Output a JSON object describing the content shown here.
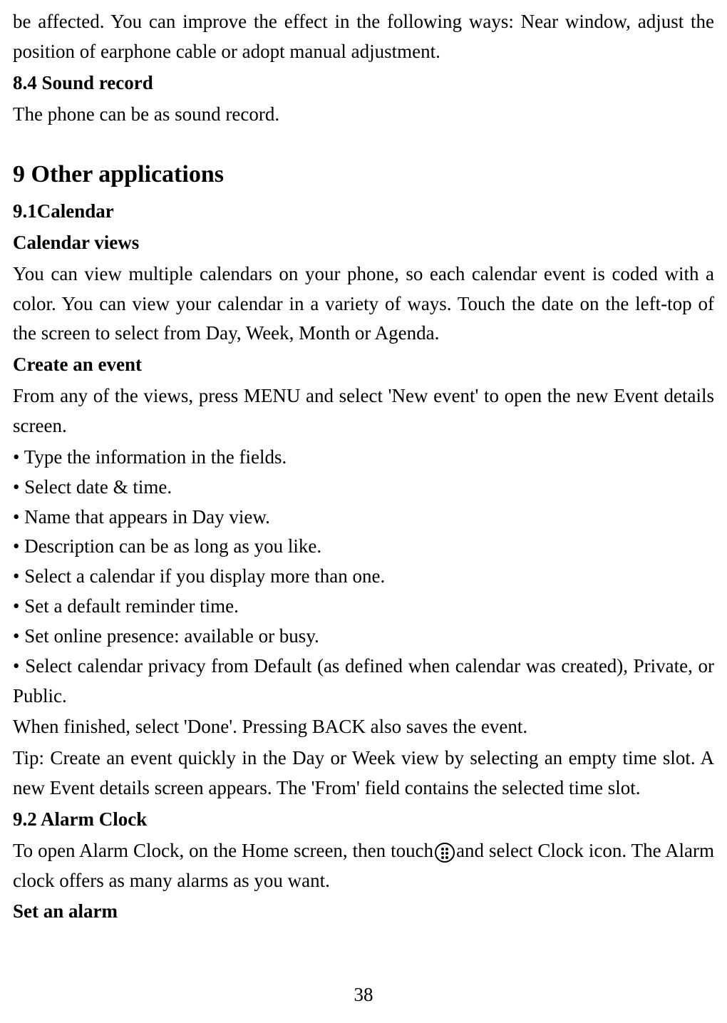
{
  "intro_paragraph": "be affected. You can improve the effect in the following ways: Near window, adjust the position of earphone cable or adopt manual adjustment.",
  "section_8_4_title": "8.4 Sound record",
  "section_8_4_body": "The phone can be as sound record.",
  "section_9_title": "9 Other applications",
  "section_9_1_title": "9.1Calendar",
  "calendar_views_heading": "Calendar views",
  "calendar_views_body": "You can view multiple calendars on your phone, so each calendar event is coded with a color. You can view your calendar in a variety of ways. Touch the date on the left-top of the screen to select from Day, Week, Month or Agenda.",
  "create_event_heading": "Create an event",
  "create_event_intro": "From any of the views, press MENU and select 'New event' to open the new Event details screen.",
  "bullets": [
    "• Type the information in the fields.",
    "• Select date & time.",
    "• Name that appears in Day view.",
    "• Description can be as long as you like.",
    "• Select a calendar if you display more than one.",
    "• Set a default reminder time.",
    "• Set online presence: available or busy.",
    "• Select calendar privacy from Default (as defined when calendar was created), Private, or Public."
  ],
  "when_finished": "When finished, select 'Done'. Pressing BACK also saves the event.",
  "tip_text": "Tip: Create an event quickly in the Day or Week view by selecting an empty time slot. A new Event details screen appears. The 'From' field contains the selected time slot.",
  "section_9_2_title": "9.2 Alarm Clock",
  "alarm_clock_line_part1": "To open Alarm Clock, on the Home screen, then touch",
  "alarm_clock_line_part2": "and select Clock icon. The Alarm clock offers as many alarms as you want.",
  "set_alarm_heading": "Set an alarm",
  "page_number": "38"
}
